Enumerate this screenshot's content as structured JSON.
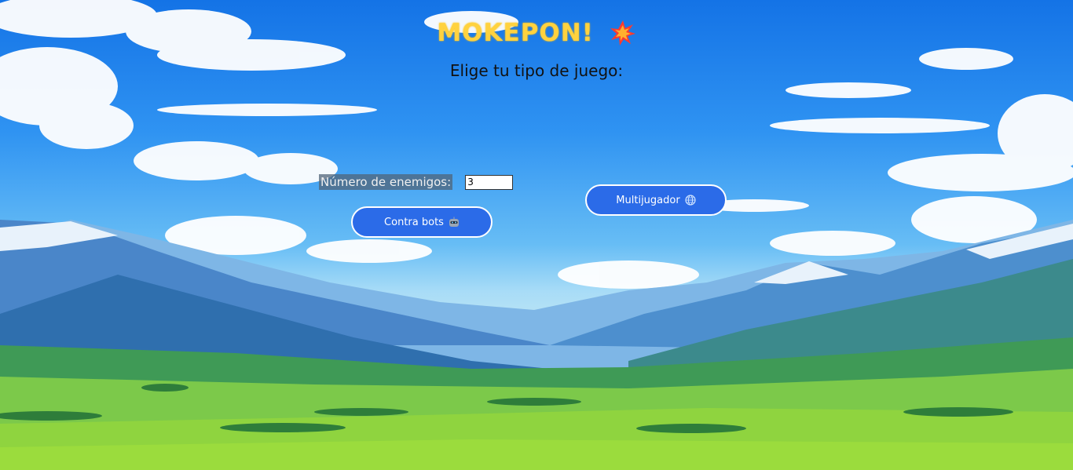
{
  "app": {
    "title": "MOKEPON!",
    "title_emoji": "collision-icon",
    "subtitle": "Elige tu tipo de juego:"
  },
  "bots": {
    "enemies_label": "Número de enemigos:",
    "enemies_value": "3",
    "button_label": "Contra bots",
    "button_icon": "robot-icon"
  },
  "multiplayer": {
    "button_label": "Multijugador",
    "button_icon": "globe-icon"
  },
  "colors": {
    "title": "#ffd23f",
    "button": "#2b6be8",
    "button_border": "#ffffff"
  }
}
